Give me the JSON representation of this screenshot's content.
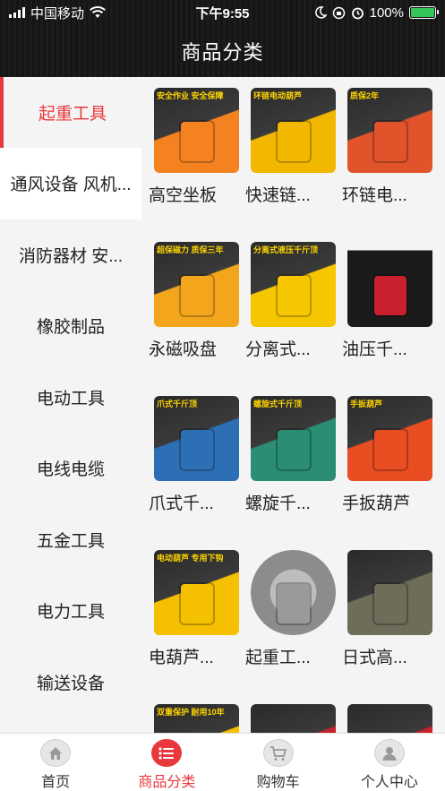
{
  "status_bar": {
    "carrier": "中国移动",
    "time": "下午9:55",
    "battery": "100%"
  },
  "header": {
    "title": "商品分类"
  },
  "sidebar": {
    "items": [
      {
        "label": "起重工具"
      },
      {
        "label": "通风设备 风机..."
      },
      {
        "label": "消防器材  安..."
      },
      {
        "label": "橡胶制品"
      },
      {
        "label": "电动工具"
      },
      {
        "label": "电线电缆"
      },
      {
        "label": "五金工具"
      },
      {
        "label": "电力工具"
      },
      {
        "label": "输送设备"
      }
    ]
  },
  "products": [
    {
      "name": "高空坐板",
      "thumb_text": "安全作业 安全保障",
      "color": "#f58220"
    },
    {
      "name": "快速链...",
      "thumb_text": "环链电动葫芦",
      "color": "#f2b800"
    },
    {
      "name": "环链电...",
      "thumb_text": "质保2年",
      "color": "#e0532b"
    },
    {
      "name": "永磁吸盘",
      "thumb_text": "超保磁力 质保三年",
      "color": "#f3a51b"
    },
    {
      "name": "分离式...",
      "thumb_text": "分离式液压千斤顶",
      "color": "#f6c700"
    },
    {
      "name": "油压千...",
      "thumb_text": "",
      "color": "#c8202c"
    },
    {
      "name": "爪式千...",
      "thumb_text": "爪式千斤顶",
      "color": "#2d6fb5"
    },
    {
      "name": "螺旋千...",
      "thumb_text": "螺旋式千斤顶",
      "color": "#2a8d74"
    },
    {
      "name": "手扳葫芦",
      "thumb_text": "手扳葫芦",
      "color": "#e94d22"
    },
    {
      "name": "电葫芦...",
      "thumb_text": "电动葫芦 专用下钩",
      "color": "#f5c000"
    },
    {
      "name": "起重工...",
      "thumb_text": "",
      "color": "#9a9a9a"
    },
    {
      "name": "日式高...",
      "thumb_text": "",
      "color": "#6d6d5a"
    },
    {
      "name": "",
      "thumb_text": "双重保护 耐用10年",
      "color": "#f5c000"
    },
    {
      "name": "",
      "thumb_text": "",
      "color": "#c8202c"
    },
    {
      "name": "",
      "thumb_text": "",
      "color": "#c8202c"
    }
  ],
  "tabbar": {
    "items": [
      {
        "label": "首页",
        "icon": "home-icon"
      },
      {
        "label": "商品分类",
        "icon": "list-icon"
      },
      {
        "label": "购物车",
        "icon": "cart-icon"
      },
      {
        "label": "个人中心",
        "icon": "user-icon"
      }
    ]
  },
  "colors": {
    "accent": "#e8383d",
    "header_bg": "#1a1a1a"
  }
}
